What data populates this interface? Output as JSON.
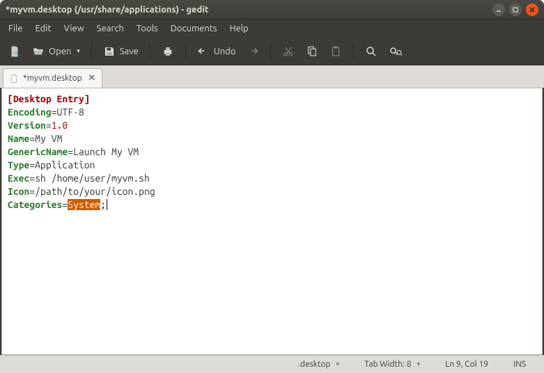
{
  "titlebar": {
    "title": "*myvm.desktop (/usr/share/applications) - gedit"
  },
  "menubar": {
    "items": [
      "File",
      "Edit",
      "View",
      "Search",
      "Tools",
      "Documents",
      "Help"
    ]
  },
  "toolbar": {
    "open_label": "Open",
    "save_label": "Save",
    "undo_label": "Undo"
  },
  "tab": {
    "label": "*myvm.desktop"
  },
  "editor": {
    "section": "[Desktop Entry]",
    "lines": [
      {
        "key": "Encoding",
        "val": "UTF-8"
      },
      {
        "key": "Version",
        "val_pre": "1",
        "val_dot": ".",
        "val_post": "0"
      },
      {
        "key": "Name",
        "val": "My VM"
      },
      {
        "key": "GenericName",
        "val": "Launch My VM"
      },
      {
        "key": "Type",
        "val": "Application"
      },
      {
        "key": "Exec",
        "val": "sh /home/user/myvm.sh"
      },
      {
        "key": "Icon",
        "val": "/path/to/your/icon.png"
      },
      {
        "key": "Categories",
        "val_sel": "System",
        "val_after": ";"
      }
    ]
  },
  "statusbar": {
    "lang": ".desktop",
    "tabwidth": "Tab Width: 8",
    "position": "Ln 9, Col 19",
    "insmode": "INS"
  }
}
